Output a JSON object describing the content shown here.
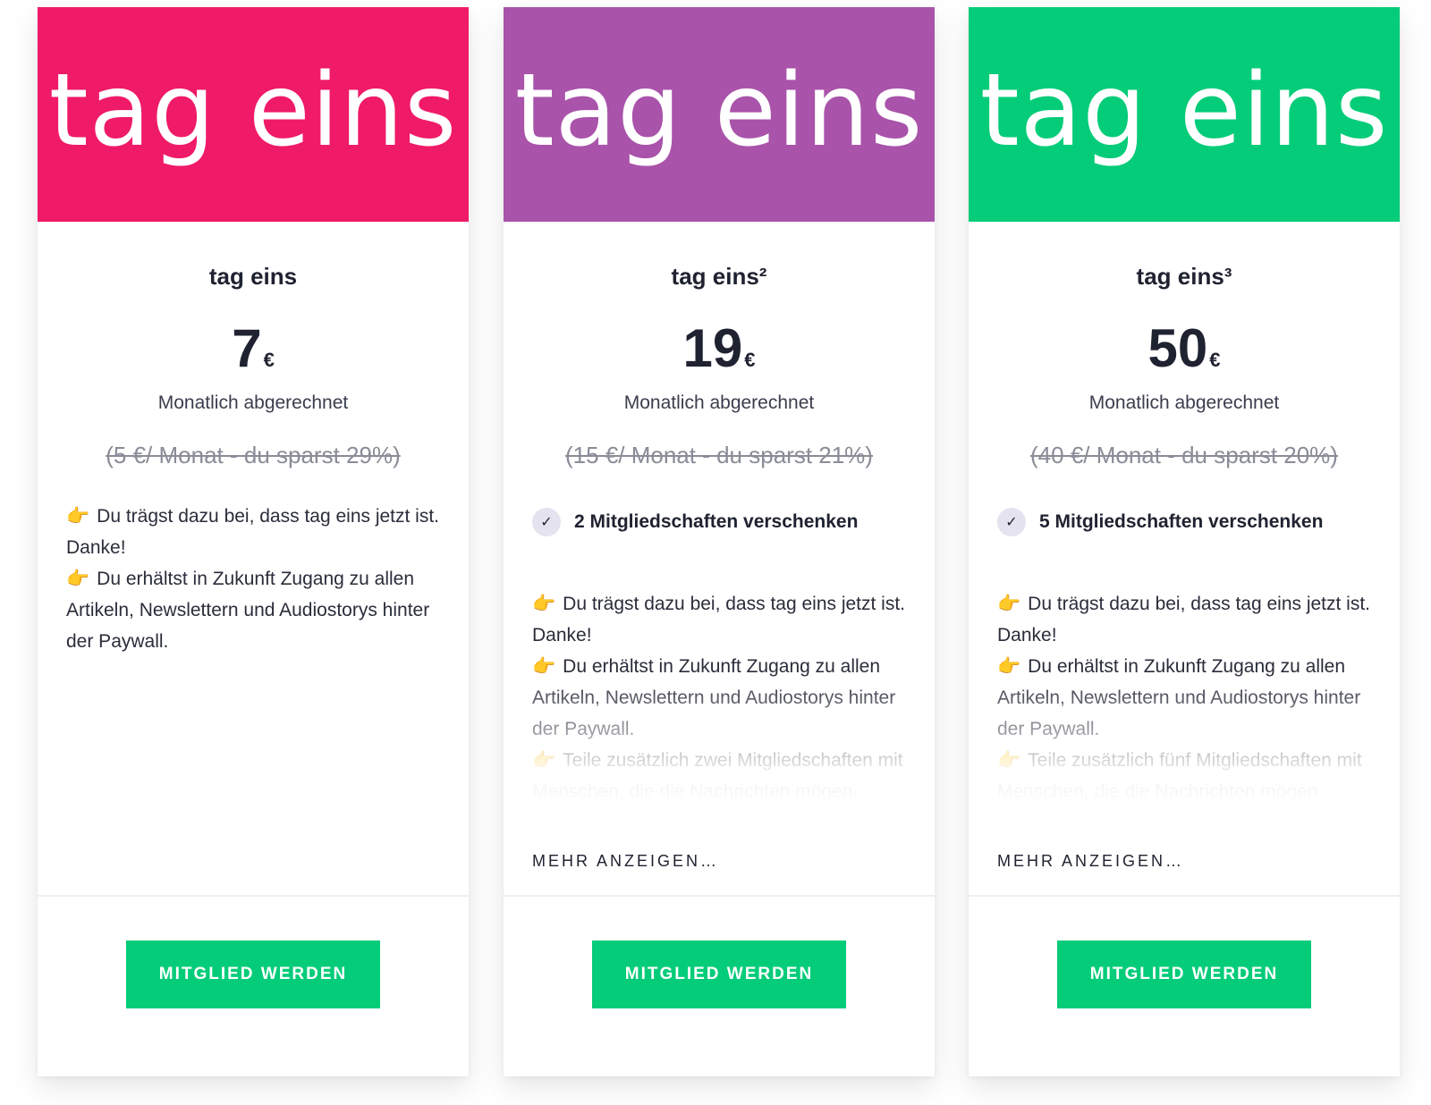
{
  "plans": [
    {
      "banner_text": "tag eins",
      "banner_color": "#EF1A68",
      "name": "tag eins",
      "price_amount": "7",
      "currency": "€",
      "billing": "Monatlich abgerechnet",
      "old_price": "(5 €/ Monat - du sparst 29%)",
      "features": [
        "Du trägst dazu bei, dass tag eins jetzt ist. Danke!",
        "Du erhältst in Zukunft Zugang zu allen Artikeln, Newslettern und Audiostorys hinter der Paywall."
      ],
      "cta": "MITGLIED WERDEN"
    },
    {
      "banner_text": "tag eins",
      "banner_color": "#A953AA",
      "name": "tag eins²",
      "price_amount": "19",
      "currency": "€",
      "billing": "Monatlich abgerechnet",
      "old_price": "(15 €/ Monat - du sparst 21%)",
      "gift": "2 Mitgliedschaften verschenken",
      "features": [
        "Du trägst dazu bei, dass tag eins jetzt ist. Danke!",
        "Du erhältst in Zukunft Zugang zu allen Artikeln, Newslettern und Audiostorys hinter der Paywall.",
        "Teile zusätzlich zwei Mitgliedschaften mit Menschen, die die Nachrichten mögen."
      ],
      "more": "MEHR ANZEIGEN…",
      "cta": "MITGLIED WERDEN"
    },
    {
      "banner_text": "tag eins",
      "banner_color": "#05CC79",
      "name": "tag eins³",
      "price_amount": "50",
      "currency": "€",
      "billing": "Monatlich abgerechnet",
      "old_price": "(40 €/ Monat - du sparst 20%)",
      "gift": "5 Mitgliedschaften verschenken",
      "features": [
        "Du trägst dazu bei, dass tag eins jetzt ist. Danke!",
        "Du erhältst in Zukunft Zugang zu allen Artikeln, Newslettern und Audiostorys hinter der Paywall.",
        "Teile zusätzlich fünf Mitgliedschaften mit Menschen, die die Nachrichten mögen."
      ],
      "more": "MEHR ANZEIGEN…",
      "cta": "MITGLIED WERDEN"
    }
  ],
  "icons": {
    "hand": "backhand-index-pointing-right-icon",
    "check": "check-icon"
  },
  "colors": {
    "cta": "#05CC79",
    "check_bg": "#E4E3EF"
  }
}
